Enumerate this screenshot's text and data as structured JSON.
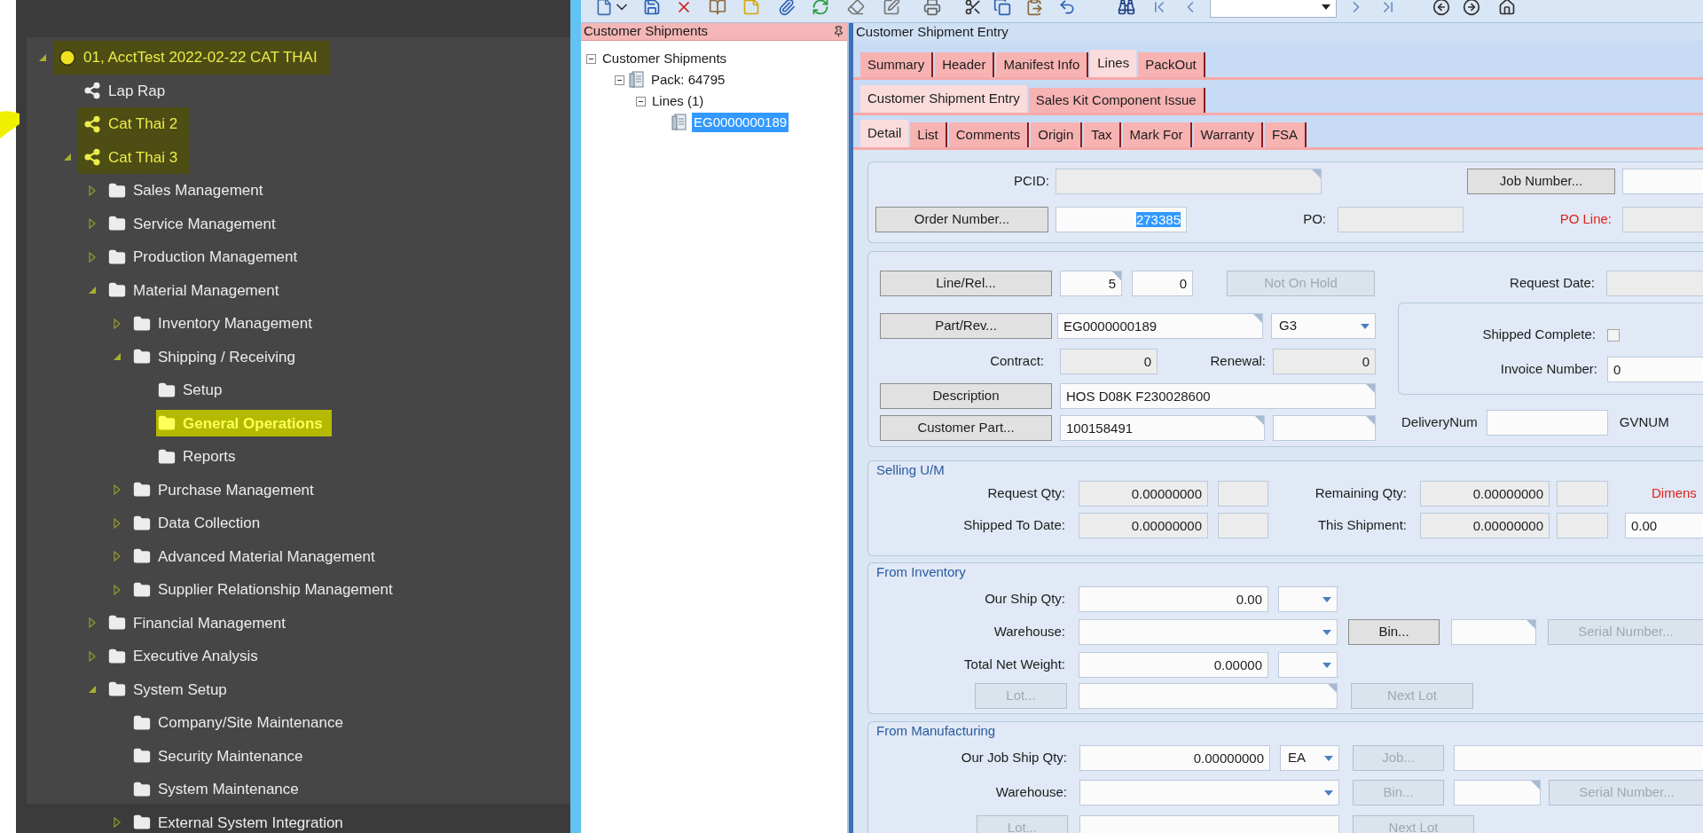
{
  "nav_tree": [
    {
      "label": "01, AcctTest 2022-02-22 CAT THAI",
      "kind": "company",
      "expanded": true,
      "highlighted": true,
      "selected": false,
      "children": [
        {
          "label": "Lap Rap",
          "kind": "site",
          "highlighted": false,
          "selected": false
        },
        {
          "label": "Cat Thai 2",
          "kind": "site",
          "highlighted": true,
          "selected": false
        },
        {
          "label": "Cat Thai 3",
          "kind": "site",
          "expanded": true,
          "highlighted": true,
          "selected": false,
          "children": [
            {
              "label": "Sales Management",
              "kind": "folder",
              "expanded": false,
              "highlighted": false,
              "selected": false
            },
            {
              "label": "Service Management",
              "kind": "folder",
              "expanded": false,
              "highlighted": false,
              "selected": false
            },
            {
              "label": "Production Management",
              "kind": "folder",
              "expanded": false,
              "highlighted": false,
              "selected": false
            },
            {
              "label": "Material Management",
              "kind": "folder",
              "expanded": true,
              "highlighted": false,
              "selected": false,
              "children": [
                {
                  "label": "Inventory Management",
                  "kind": "folder",
                  "expanded": false,
                  "highlighted": false,
                  "selected": false
                },
                {
                  "label": "Shipping / Receiving",
                  "kind": "folder",
                  "expanded": true,
                  "highlighted": false,
                  "selected": false,
                  "children": [
                    {
                      "label": "Setup",
                      "kind": "folder",
                      "highlighted": false,
                      "selected": false
                    },
                    {
                      "label": "General Operations",
                      "kind": "folder",
                      "highlighted": false,
                      "selected": true
                    },
                    {
                      "label": "Reports",
                      "kind": "folder",
                      "highlighted": false,
                      "selected": false
                    }
                  ]
                },
                {
                  "label": "Purchase Management",
                  "kind": "folder",
                  "expanded": false,
                  "highlighted": false,
                  "selected": false
                },
                {
                  "label": "Data Collection",
                  "kind": "folder",
                  "expanded": false,
                  "highlighted": false,
                  "selected": false
                },
                {
                  "label": "Advanced Material Management",
                  "kind": "folder",
                  "expanded": false,
                  "highlighted": false,
                  "selected": false
                },
                {
                  "label": "Supplier Relationship Management",
                  "kind": "folder",
                  "expanded": false,
                  "highlighted": false,
                  "selected": false
                }
              ]
            },
            {
              "label": "Financial Management",
              "kind": "folder",
              "expanded": false,
              "highlighted": false,
              "selected": false
            },
            {
              "label": "Executive Analysis",
              "kind": "folder",
              "expanded": false,
              "highlighted": false,
              "selected": false
            },
            {
              "label": "System Setup",
              "kind": "folder",
              "expanded": true,
              "highlighted": false,
              "selected": false,
              "children": [
                {
                  "label": "Company/Site Maintenance",
                  "kind": "folder",
                  "highlighted": false,
                  "selected": false
                },
                {
                  "label": "Security Maintenance",
                  "kind": "folder",
                  "highlighted": false,
                  "selected": false
                },
                {
                  "label": "System Maintenance",
                  "kind": "folder",
                  "highlighted": false,
                  "selected": false
                },
                {
                  "label": "External System Integration",
                  "kind": "folder",
                  "expanded": false,
                  "highlighted": false,
                  "selected": false
                }
              ]
            }
          ]
        }
      ]
    }
  ],
  "shipments_panel": {
    "title": "Customer Shipments",
    "tree": [
      {
        "label": "Customer Shipments",
        "expanded": true,
        "selected": false,
        "children": [
          {
            "label": "Pack: 64795",
            "kind": "document",
            "expanded": true,
            "selected": false,
            "children": [
              {
                "label": "Lines (1)",
                "expanded": true,
                "selected": false,
                "children": [
                  {
                    "label": "EG0000000189",
                    "kind": "document",
                    "selected": true
                  }
                ]
              }
            ]
          }
        ]
      }
    ]
  },
  "entry": {
    "title": "Customer Shipment Entry",
    "tab_rows": [
      [
        {
          "label": "Summary",
          "selected": false
        },
        {
          "label": "Header",
          "selected": false
        },
        {
          "label": "Manifest Info",
          "selected": false
        },
        {
          "label": "Lines",
          "selected": true
        },
        {
          "label": "PackOut",
          "selected": false
        }
      ],
      [
        {
          "label": "Customer Shipment Entry",
          "selected": true
        },
        {
          "label": "Sales Kit Component Issue",
          "selected": false
        }
      ],
      [
        {
          "label": "Detail",
          "selected": true
        },
        {
          "label": "List",
          "selected": false
        },
        {
          "label": "Comments",
          "selected": false
        },
        {
          "label": "Origin",
          "selected": false
        },
        {
          "label": "Tax",
          "selected": false
        },
        {
          "label": "Mark For",
          "selected": false
        },
        {
          "label": "Warranty",
          "selected": false
        },
        {
          "label": "FSA",
          "selected": false
        }
      ]
    ],
    "order_panel": [
      [
        {
          "kind": "label",
          "text": "PCID:"
        },
        {
          "kind": "lookup",
          "readonly": true
        },
        {
          "kind": "button",
          "text": "Job Number...",
          "disabled": false
        },
        {
          "kind": "field",
          "readonly": false
        }
      ],
      [
        {
          "kind": "button",
          "text": "Order Number...",
          "disabled": false
        },
        {
          "kind": "field",
          "readonly": false,
          "value": "273385",
          "text_selected": true
        },
        {
          "kind": "label",
          "text": "PO:"
        },
        {
          "kind": "field",
          "readonly": true
        },
        {
          "kind": "alert_label",
          "text": "PO Line:"
        },
        {
          "kind": "field",
          "readonly": true
        }
      ]
    ],
    "line_panel": {
      "left_rows": [
        [
          {
            "kind": "button",
            "text": "Line/Rel...",
            "disabled": false
          },
          {
            "kind": "lookup",
            "readonly": false,
            "value": "5"
          },
          {
            "kind": "field",
            "readonly": false,
            "value": "0"
          },
          {
            "kind": "button",
            "text": "Not On Hold",
            "disabled": true
          }
        ],
        [
          {
            "kind": "button",
            "text": "Part/Rev...",
            "disabled": false
          },
          {
            "kind": "lookup",
            "readonly": false,
            "value": "EG0000000189"
          },
          {
            "kind": "combo",
            "value": "G3"
          }
        ],
        [
          {
            "kind": "label",
            "text": "Contract:"
          },
          {
            "kind": "field",
            "readonly": true,
            "value": "0"
          },
          {
            "kind": "label",
            "text": "Renewal:"
          },
          {
            "kind": "field",
            "readonly": true,
            "value": "0"
          }
        ],
        [
          {
            "kind": "button",
            "text": "Description",
            "disabled": false
          },
          {
            "kind": "lookup",
            "readonly": false,
            "value": "HOS D08K F230028600"
          }
        ],
        [
          {
            "kind": "button",
            "text": "Customer Part...",
            "disabled": false
          },
          {
            "kind": "lookup",
            "readonly": false,
            "value": "100158491"
          },
          {
            "kind": "lookup",
            "readonly": false
          }
        ]
      ],
      "request_row": [
        {
          "kind": "label",
          "text": "Request Date:"
        },
        {
          "kind": "field",
          "readonly": true
        }
      ],
      "status_box": [
        [
          {
            "kind": "label",
            "text": "Shipped Complete:"
          },
          {
            "kind": "checkbox",
            "checked": false
          }
        ],
        [
          {
            "kind": "label",
            "text": "Invoice Number:"
          },
          {
            "kind": "field",
            "readonly": false,
            "value": "0"
          }
        ]
      ],
      "delivery_row": [
        {
          "kind": "label",
          "text": "DeliveryNum"
        },
        {
          "kind": "field",
          "readonly": false
        },
        {
          "kind": "label",
          "text": "GVNUM"
        }
      ]
    },
    "groups": [
      {
        "title": "Selling U/M",
        "rows": [
          [
            {
              "kind": "label",
              "text": "Request Qty:"
            },
            {
              "kind": "field",
              "readonly": true,
              "value": "0.00000000"
            },
            {
              "kind": "field",
              "readonly": true
            },
            {
              "kind": "label",
              "text": "Remaining Qty:"
            },
            {
              "kind": "field",
              "readonly": true,
              "value": "0.00000000"
            },
            {
              "kind": "field",
              "readonly": true
            },
            {
              "kind": "alert_label",
              "text": "Dimens"
            }
          ],
          [
            {
              "kind": "label",
              "text": "Shipped To Date:"
            },
            {
              "kind": "field",
              "readonly": true,
              "value": "0.00000000"
            },
            {
              "kind": "field",
              "readonly": true
            },
            {
              "kind": "label",
              "text": "This Shipment:"
            },
            {
              "kind": "field",
              "readonly": true,
              "value": "0.00000000"
            },
            {
              "kind": "field",
              "readonly": true
            },
            {
              "kind": "field",
              "readonly": false,
              "value": "0.00"
            }
          ]
        ]
      },
      {
        "title": "From Inventory",
        "rows": [
          [
            {
              "kind": "label",
              "text": "Our Ship Qty:"
            },
            {
              "kind": "field",
              "readonly": false,
              "value": "0.00"
            },
            {
              "kind": "combo"
            }
          ],
          [
            {
              "kind": "label",
              "text": "Warehouse:"
            },
            {
              "kind": "combo"
            },
            {
              "kind": "button",
              "text": "Bin...",
              "disabled": false
            },
            {
              "kind": "lookup",
              "readonly": false
            },
            {
              "kind": "button",
              "text": "Serial Number...",
              "disabled": true
            }
          ],
          [
            {
              "kind": "label",
              "text": "Total Net Weight:"
            },
            {
              "kind": "field",
              "readonly": false,
              "value": "0.00000"
            },
            {
              "kind": "combo"
            }
          ],
          [
            {
              "kind": "button",
              "text": "Lot...",
              "disabled": true
            },
            {
              "kind": "lookup",
              "readonly": false
            },
            {
              "kind": "button",
              "text": "Next Lot",
              "disabled": true
            }
          ]
        ]
      },
      {
        "title": "From Manufacturing",
        "rows": [
          [
            {
              "kind": "label",
              "text": "Our Job Ship Qty:"
            },
            {
              "kind": "field",
              "readonly": false,
              "value": "0.00000000"
            },
            {
              "kind": "combo",
              "value": "EA"
            },
            {
              "kind": "button",
              "text": "Job...",
              "disabled": true
            },
            {
              "kind": "field",
              "readonly": false
            }
          ],
          [
            {
              "kind": "label",
              "text": "Warehouse:"
            },
            {
              "kind": "combo"
            },
            {
              "kind": "button",
              "text": "Bin...",
              "disabled": true
            },
            {
              "kind": "lookup",
              "readonly": false
            },
            {
              "kind": "button",
              "text": "Serial Number...",
              "disabled": true
            }
          ],
          [
            {
              "kind": "button",
              "text": "Lot...",
              "disabled": true
            },
            {
              "kind": "field",
              "readonly": false
            },
            {
              "kind": "button",
              "text": "Next Lot",
              "disabled": true
            }
          ]
        ]
      }
    ]
  }
}
